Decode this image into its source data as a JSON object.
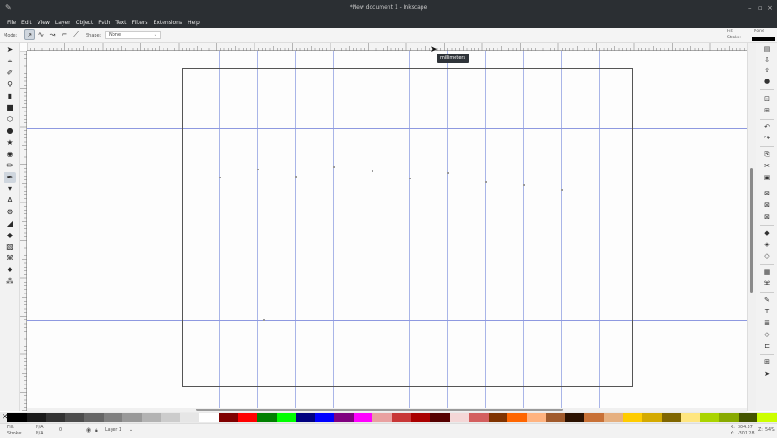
{
  "window": {
    "title": "*New document 1 - Inkscape",
    "controls": [
      "–",
      "▫",
      "×"
    ]
  },
  "menu": [
    "File",
    "Edit",
    "View",
    "Layer",
    "Object",
    "Path",
    "Text",
    "Filters",
    "Extensions",
    "Help"
  ],
  "tool_controls": {
    "mode_label": "Mode:",
    "shape_label": "Shape:",
    "shape_value": "None",
    "fill_label": "Fill:",
    "fill_value": "None",
    "stroke_label": "Stroke:"
  },
  "tooltip": "millimeters",
  "status": {
    "fill_label": "Fill:",
    "fill_value": "N/A",
    "stroke_label": "Stroke:",
    "stroke_value": "N/A",
    "opacity": "0",
    "layer": "Layer 1",
    "x_label": "X:",
    "x_value": "304.37",
    "y_label": "Y:",
    "y_value": "-301.28",
    "zoom_label": "Z:",
    "zoom_value": "54%"
  },
  "colors": {
    "chrome_dark": "#2b2f33",
    "guide": "#8e99e0",
    "page_border": "#555555",
    "palette": [
      "#000000",
      "#1a1a1a",
      "#333333",
      "#4d4d4d",
      "#666666",
      "#808080",
      "#999999",
      "#b3b3b3",
      "#cccccc",
      "#e6e6e6",
      "#ffffff",
      "#800000",
      "#ff0000",
      "#008000",
      "#00ff00",
      "#000080",
      "#0000ff",
      "#800080",
      "#ff00ff",
      "#e9a0a0",
      "#c83737",
      "#aa0000",
      "#550000",
      "#f4d7d7",
      "#d35f5f",
      "#803300",
      "#ff6600",
      "#ffb380",
      "#a05a2c",
      "#2b1100",
      "#c87137",
      "#e6b080",
      "#ffcc00",
      "#d4aa00",
      "#806600",
      "#ffe680",
      "#aad400",
      "#88aa00",
      "#445500",
      "#ccff00"
    ]
  }
}
